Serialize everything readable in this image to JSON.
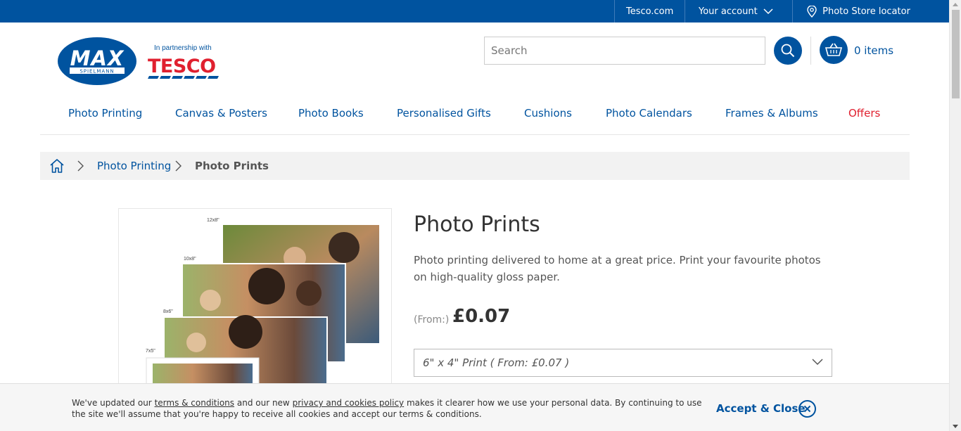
{
  "topbar": {
    "tesco_link": "Tesco.com",
    "account_label": "Your account",
    "store_locator": "Photo Store locator"
  },
  "brand": {
    "max_text": "MAX",
    "max_sub": "SPIELMANN",
    "partner_text": "In partnership with",
    "tesco_text": "TESCO",
    "primary_color": "#00539f",
    "accent_color": "#e0202f"
  },
  "header": {
    "search_placeholder": "Search",
    "basket_count": "0 items"
  },
  "nav": {
    "items": [
      {
        "label": "Photo Printing"
      },
      {
        "label": "Canvas & Posters"
      },
      {
        "label": "Photo Books"
      },
      {
        "label": "Personalised Gifts"
      },
      {
        "label": "Cushions"
      },
      {
        "label": "Photo Calendars"
      },
      {
        "label": "Frames & Albums"
      },
      {
        "label": "Offers"
      }
    ]
  },
  "breadcrumb": {
    "parent": "Photo Printing",
    "current": "Photo Prints"
  },
  "product": {
    "image_sizes": [
      "12x8\"",
      "10x8\"",
      "8x6\"",
      "7x5\""
    ],
    "title": "Photo Prints",
    "description": "Photo printing delivered to home at a great price. Print your favourite photos on high-quality gloss paper.",
    "price_prefix": "(From:)",
    "price": "£0.07",
    "size_option": "6\" x 4\" Print ( From: £0.07 )"
  },
  "cookie": {
    "t1": "We've updated our ",
    "terms_link": "terms & conditions",
    "t2": " and our new ",
    "privacy_link": "privacy and cookies policy",
    "t3": " makes it clearer how we use your personal data. By continuing to use the site we'll assume that you're happy to receive all cookies and accept our terms & conditions.",
    "accept_label": "Accept & Close"
  }
}
